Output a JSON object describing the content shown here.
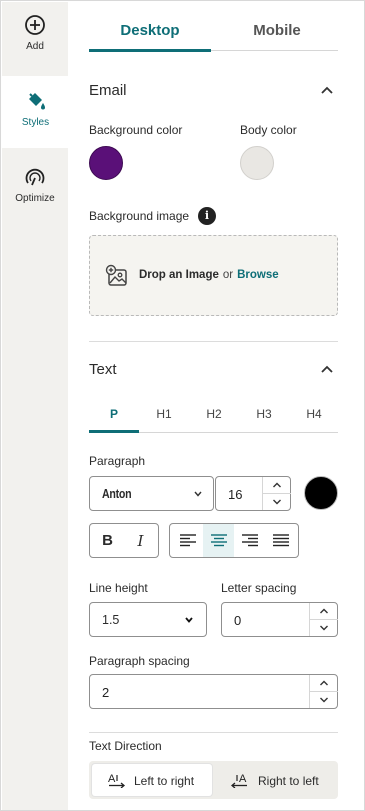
{
  "rail": {
    "add_label": "Add",
    "styles_label": "Styles",
    "optimize_label": "Optimize"
  },
  "tabs": {
    "desktop": "Desktop",
    "mobile": "Mobile"
  },
  "email": {
    "title": "Email",
    "bg_color_label": "Background color",
    "body_color_label": "Body color",
    "bg_color": "#5a1078",
    "body_color": "#e9e7e3",
    "bg_image_label": "Background image",
    "info_glyph": "i",
    "drop_text": "Drop an Image",
    "or_text": "or",
    "browse_text": "Browse"
  },
  "text": {
    "title": "Text",
    "subtabs": [
      "P",
      "H1",
      "H2",
      "H3",
      "H4"
    ],
    "active_subtab": "P",
    "paragraph_label": "Paragraph",
    "font_value": "Anton",
    "size_value": "16",
    "text_color": "#000000",
    "bold_glyph": "B",
    "italic_glyph": "I",
    "active_alignment": "center",
    "line_height_label": "Line height",
    "line_height_value": "1.5",
    "letter_spacing_label": "Letter spacing",
    "letter_spacing_value": "0",
    "paragraph_spacing_label": "Paragraph spacing",
    "paragraph_spacing_value": "2",
    "direction_label": "Text Direction",
    "ltr_label": "Left to right",
    "rtl_label": "Right to left",
    "active_direction": "ltr"
  },
  "colors": {
    "accent": "#0e6e77"
  }
}
